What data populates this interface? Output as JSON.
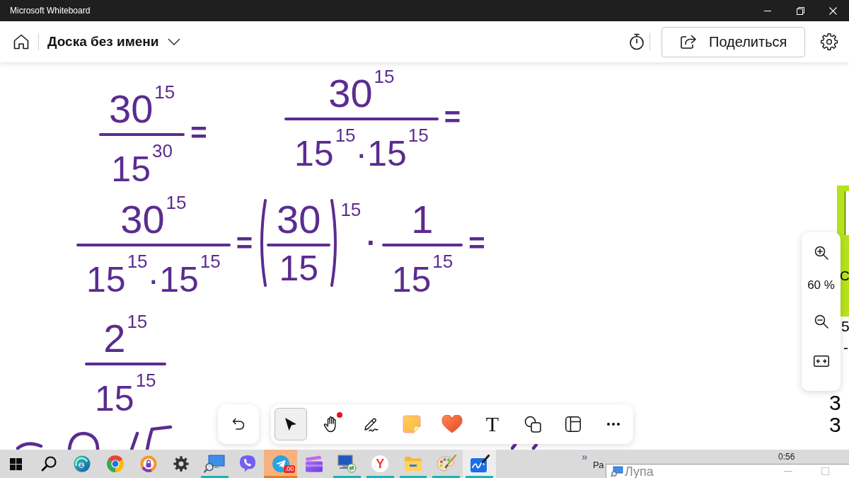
{
  "window": {
    "title": "Microsoft Whiteboard"
  },
  "app_bar": {
    "board_title": "Доска без имени",
    "share_label": "Поделиться"
  },
  "canvas": {
    "ink": [
      {
        "parts": [
          {
            "kind": "fraction",
            "numerator": "30$^{15}$",
            "denominator": "15$^{30}$"
          },
          {
            "kind": "sign",
            "text": "="
          }
        ]
      },
      {
        "parts": [
          {
            "kind": "fraction",
            "numerator": "30$^{15}$",
            "denominator": "15$^{15}$·15$^{15}$"
          },
          {
            "kind": "sign",
            "text": "="
          }
        ]
      },
      {
        "parts": [
          {
            "kind": "fraction",
            "numerator": "30$^{15}$",
            "denominator": "15$^{15}$·15$^{15}$"
          },
          {
            "kind": "sign",
            "text": "="
          },
          {
            "kind": "paren_fraction",
            "numerator": "30",
            "denominator": "15",
            "exponent": "15"
          },
          {
            "kind": "sign",
            "text": "·"
          },
          {
            "kind": "fraction",
            "numerator": "1",
            "denominator": "15$^{15}$"
          },
          {
            "kind": "sign",
            "text": "="
          }
        ]
      },
      {
        "parts": [
          {
            "kind": "fraction",
            "numerator": "2$^{15}$",
            "denominator": "15$^{15}$"
          }
        ]
      }
    ],
    "edge_note": {
      "text": "C"
    },
    "edge_texts": [
      "5",
      "-",
      "3",
      "3"
    ]
  },
  "zoom_panel": {
    "level_label": "60 %"
  },
  "toolbar": {
    "tools": [
      {
        "kind": "select",
        "selected": true,
        "dot": false
      },
      {
        "kind": "hand",
        "selected": false,
        "dot": true
      },
      {
        "kind": "pen",
        "selected": false,
        "dot": false
      },
      {
        "kind": "sticky_note",
        "selected": false,
        "dot": false
      },
      {
        "kind": "reaction",
        "selected": false,
        "dot": false
      },
      {
        "kind": "text",
        "label": "T",
        "selected": false,
        "dot": false
      },
      {
        "kind": "shapes",
        "selected": false,
        "dot": false
      },
      {
        "kind": "templates",
        "selected": false,
        "dot": false
      },
      {
        "kind": "more",
        "selected": false,
        "dot": false
      }
    ]
  },
  "taskbar": {
    "items": [
      {
        "kind": "start",
        "running": false,
        "flashing": false,
        "active": false
      },
      {
        "kind": "search",
        "running": false,
        "flashing": false,
        "active": false
      },
      {
        "kind": "swirl_browser",
        "running": false,
        "flashing": false,
        "active": false
      },
      {
        "kind": "ring_browser",
        "running": false,
        "flashing": false,
        "active": false
      },
      {
        "kind": "lock_browser",
        "running": false,
        "flashing": false,
        "active": false
      },
      {
        "kind": "settings",
        "running": false,
        "flashing": false,
        "active": false
      },
      {
        "kind": "magnifier",
        "running": true,
        "flashing": false,
        "active": false
      },
      {
        "kind": "phone_chat",
        "running": false,
        "flashing": false,
        "active": false
      },
      {
        "kind": "messenger",
        "running": true,
        "flashing": true,
        "active": false,
        "badge": ".00"
      },
      {
        "kind": "video_editor",
        "running": false,
        "flashing": false,
        "active": false
      },
      {
        "kind": "remote_desktop",
        "running": true,
        "flashing": false,
        "active": false
      },
      {
        "kind": "letter_browser",
        "label": "Y",
        "running": true,
        "flashing": false,
        "active": false
      },
      {
        "kind": "file_explorer",
        "running": true,
        "flashing": false,
        "active": false
      },
      {
        "kind": "paint",
        "running": true,
        "flashing": false,
        "active": false
      },
      {
        "kind": "whiteboard",
        "running": true,
        "flashing": false,
        "active": true
      }
    ],
    "overflow": "»",
    "clipped_label": "Ра",
    "clock": "0:56"
  },
  "magnifier_window": {
    "title": "Лупа"
  }
}
